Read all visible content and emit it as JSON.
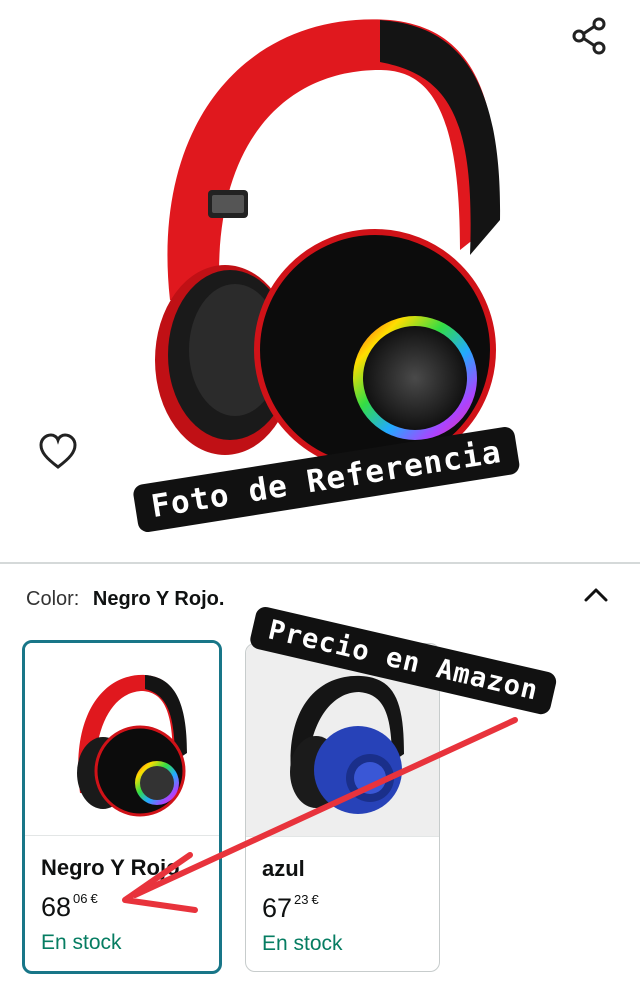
{
  "hero": {
    "share_icon": "share-icon",
    "favorite_icon": "heart-outline-icon",
    "reference_sticker": "Foto de Referencia"
  },
  "variation": {
    "label": "Color:",
    "selected_value": "Negro Y Rojo.",
    "collapse_icon": "chevron-up-icon"
  },
  "price_sticker": "Precio en Amazon",
  "options": [
    {
      "name": "Negro Y Rojo.",
      "price_whole": "68",
      "price_cents": "06",
      "currency": "€",
      "stock": "En stock",
      "selected": true
    },
    {
      "name": "azul",
      "price_whole": "67",
      "price_cents": "23",
      "currency": "€",
      "stock": "En stock",
      "selected": false
    }
  ],
  "colors": {
    "selected_border": "#187688",
    "stock_green": "#067d62",
    "arrow_red": "#e8333c"
  }
}
